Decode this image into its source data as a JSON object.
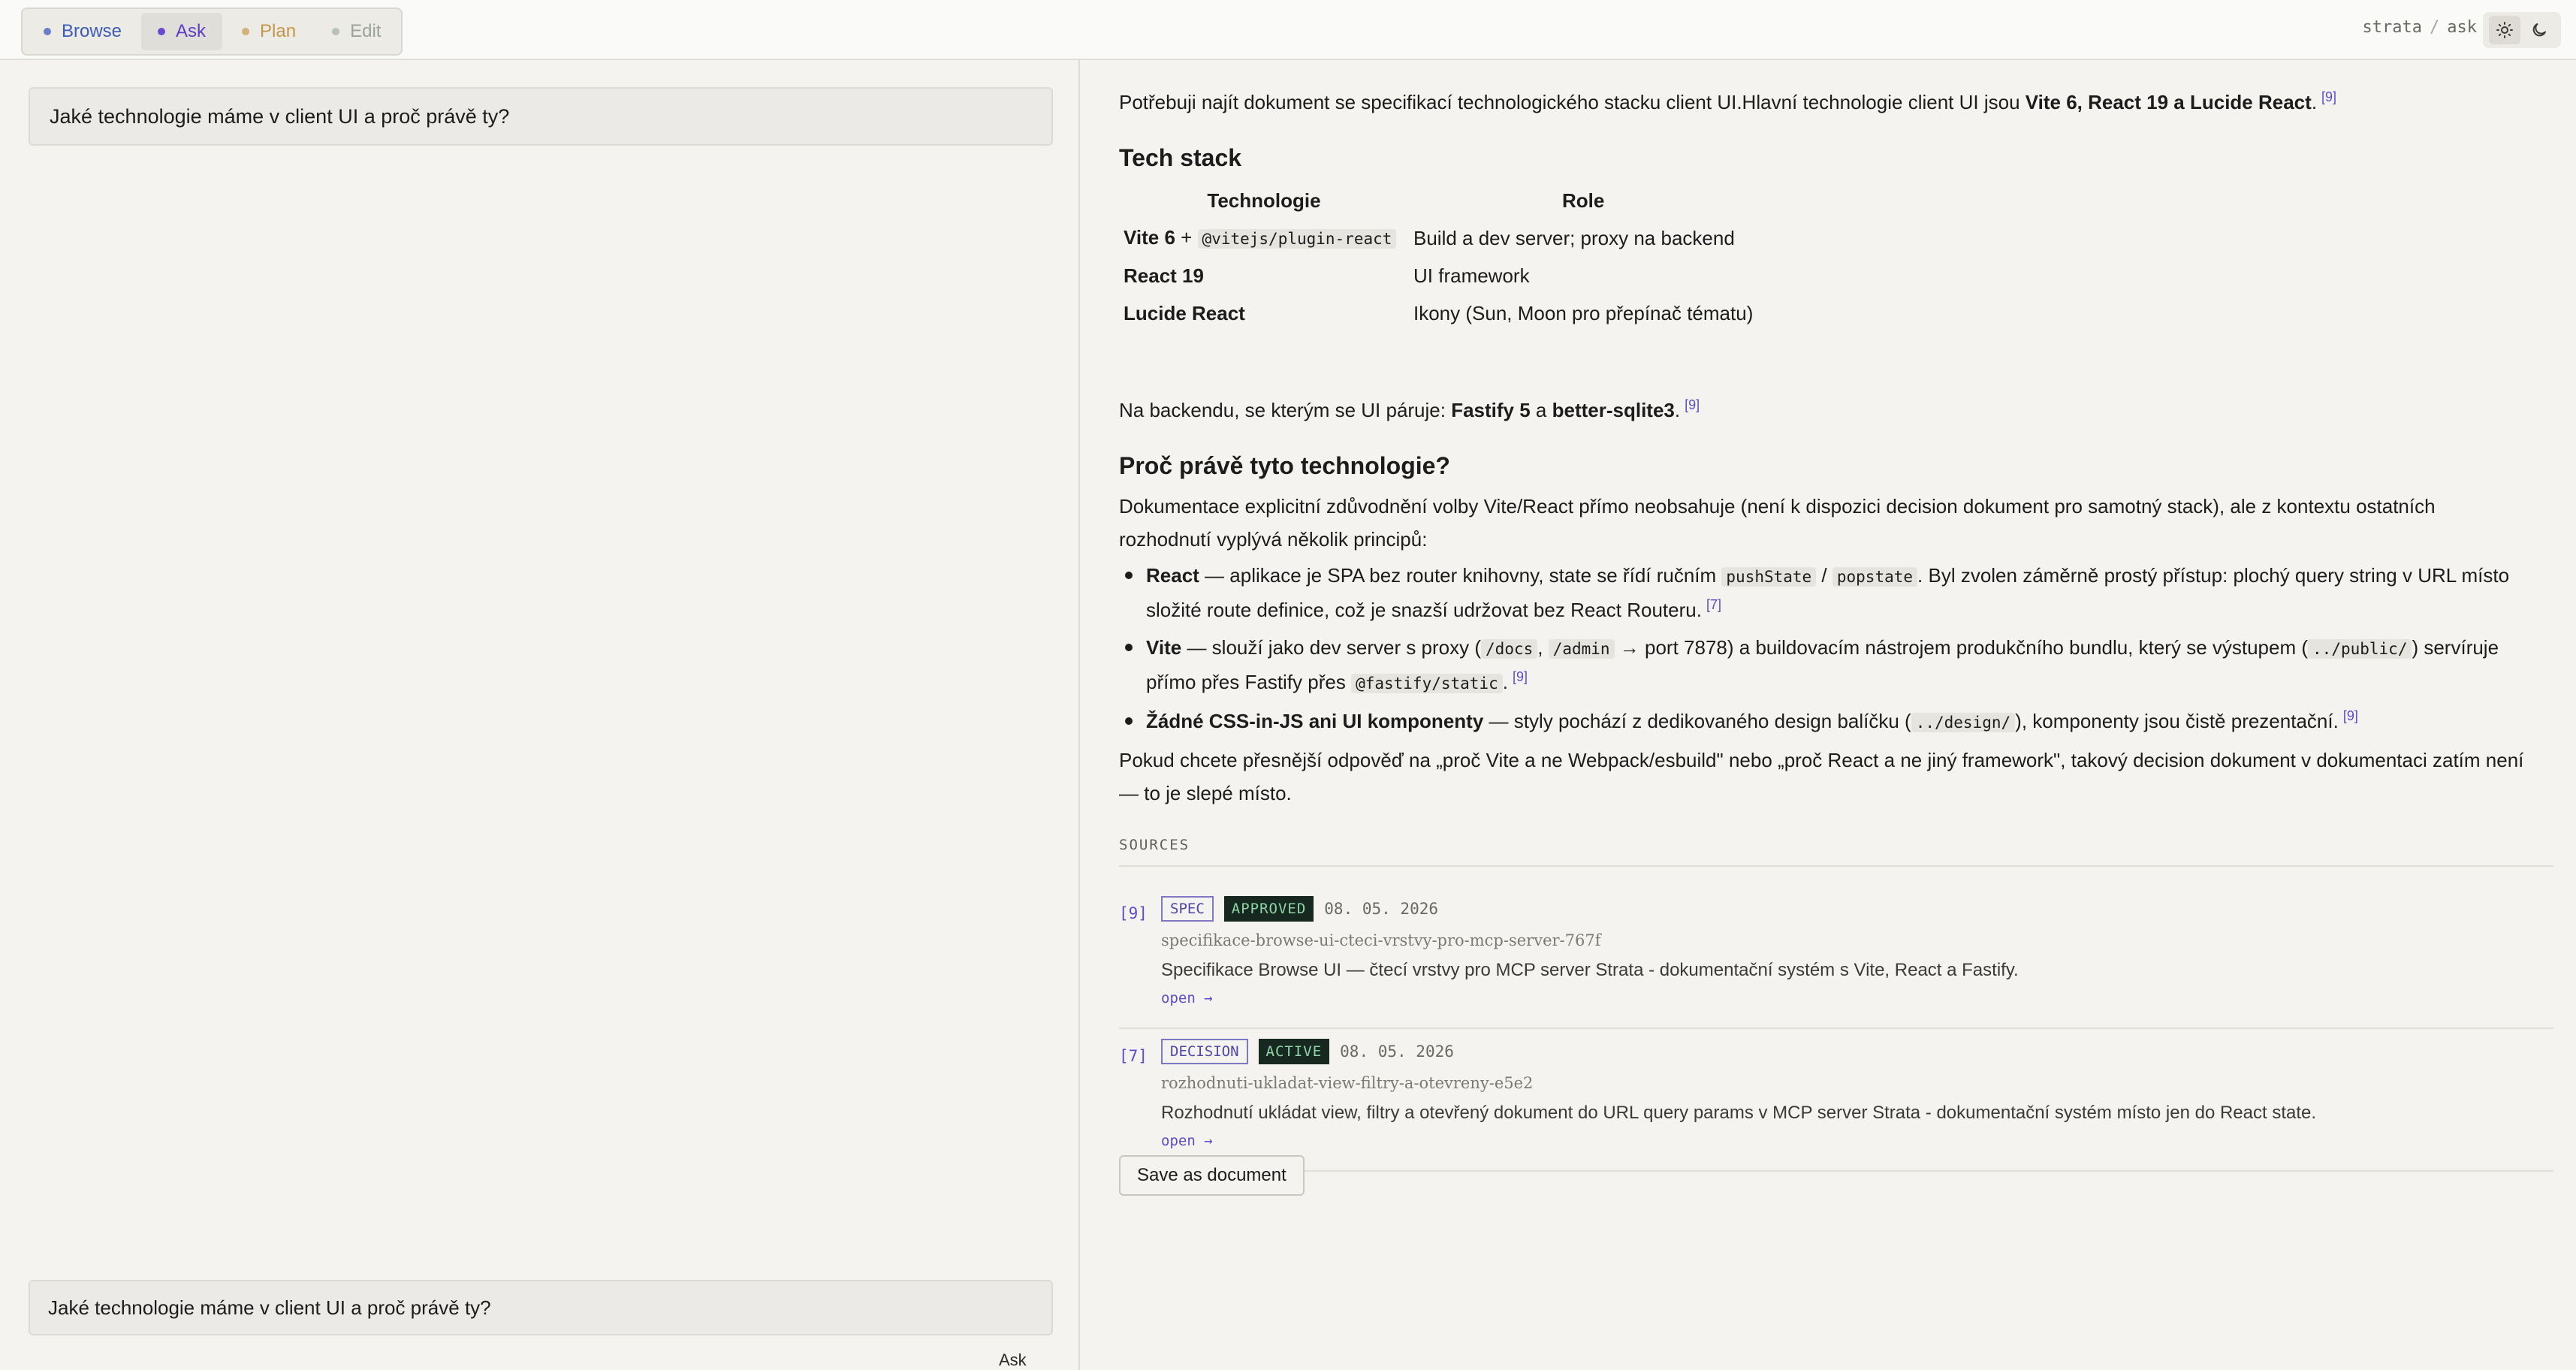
{
  "header": {
    "modes": [
      {
        "label": "Browse",
        "color": "#3b5bb5",
        "dot": "#6b7fc8"
      },
      {
        "label": "Ask",
        "color": "#5b3dc8",
        "dot": "#6a4bd0"
      },
      {
        "label": "Plan",
        "color": "#c4964a",
        "dot": "#d4b07a"
      },
      {
        "label": "Edit",
        "color": "#9aa39a",
        "dot": "#b8c2b8"
      }
    ],
    "active_mode": "Ask",
    "breadcrumb": {
      "app": "strata",
      "sep": "/",
      "page": "ask"
    },
    "theme_icons": [
      "sun-icon",
      "moon-icon"
    ]
  },
  "chat": {
    "question": "Jaké technologie máme v client UI a proč právě ty?",
    "input_value": "Jaké technologie máme v client UI a proč právě ty?",
    "ask_label": "Ask"
  },
  "answer": {
    "intro_plain": "Potřebuji najít dokument se specifikací technologického stacku client UI.Hlavní technologie client UI jsou ",
    "intro_bold": "Vite 6, React 19 a Lucide React",
    "intro_end": ".",
    "intro_cite": "[9]",
    "tech_heading": "Tech stack",
    "table": {
      "col1": "Technologie",
      "col2": "Role",
      "rows": [
        {
          "name": "Vite 6",
          "joiner": " + ",
          "code": "@vitejs/plugin-react",
          "role": "Build a dev server; proxy na backend"
        },
        {
          "name": "React 19",
          "role": "UI framework"
        },
        {
          "name": "Lucide React",
          "role": "Ikony (Sun, Moon pro přepínač tématu)"
        }
      ]
    },
    "backend": {
      "pre": "Na backendu, se kterým se UI páruje: ",
      "b1": "Fastify 5",
      "mid": " a ",
      "b2": "better-sqlite3",
      "end": ".",
      "cite": "[9]"
    },
    "why_heading": "Proč právě tyto technologie?",
    "doc_note": "Dokumentace explicitní zdůvodnění volby Vite/React přímo neobsahuje (není k dispozici decision dokument pro samotný stack), ale z kontextu ostatních rozhodnutí vyplývá několik principů:",
    "bullets": {
      "react": {
        "title": "React",
        "t1": " — aplikace je SPA bez router knihovny, state se řídí ručním ",
        "c1": "pushState",
        "t2": " / ",
        "c2": "popstate",
        "t3": ". Byl zvolen záměrně prostý přístup: plochý query string v URL místo složité route definice, což je snazší udržovat bez React Routeru.",
        "cite": "[7]"
      },
      "vite": {
        "title": "Vite",
        "t1": " — slouží jako dev server s proxy (",
        "c1": "/docs",
        "t2": ", ",
        "c2": "/admin",
        "t3": " → port 7878) a buildovacím nástrojem produkčního bundlu, který se výstupem (",
        "c3": "../public/",
        "t4": ") servíruje přímo přes Fastify přes ",
        "c4": "@fastify/static",
        "t5": ".",
        "cite": "[9]"
      },
      "css": {
        "title": "Žádné CSS-in-JS ani UI komponenty",
        "t1": " — styly pochází z dedikovaného design balíčku (",
        "c1": "../design/",
        "t2": "), komponenty jsou čistě prezentační.",
        "cite": "[9]"
      }
    },
    "closing": "Pokud chcete přesnější odpověď na „proč Vite a ne Webpack/esbuild\" nebo „proč React a ne jiný framework\", takový decision dokument v dokumentaci zatím není — to je slepé místo.",
    "sources_label": "SOURCES",
    "sources": [
      {
        "num": "[9]",
        "type": "SPEC",
        "status": "APPROVED",
        "date": "08. 05. 2026",
        "slug": "specifikace-browse-ui-cteci-vrstvy-pro-mcp-server-767f",
        "desc": "Specifikace Browse UI — čtecí vrstvy pro MCP server Strata - dokumentační systém s Vite, React a Fastify.",
        "open": "open →"
      },
      {
        "num": "[7]",
        "type": "DECISION",
        "status": "ACTIVE",
        "date": "08. 05. 2026",
        "slug": "rozhodnuti-ukladat-view-filtry-a-otevreny-e5e2",
        "desc": "Rozhodnutí ukládat view, filtry a otevřený dokument do URL query params v MCP server Strata - dokumentační systém místo jen do React state.",
        "open": "open →"
      }
    ],
    "save_label": "Save as document"
  }
}
